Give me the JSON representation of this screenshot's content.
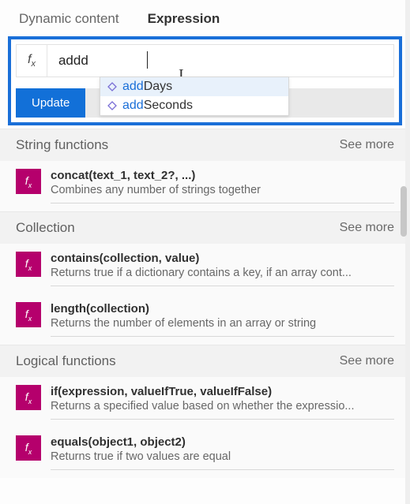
{
  "tabs": {
    "dynamic": "Dynamic content",
    "expression": "Expression"
  },
  "expr": {
    "value": "addd",
    "update": "Update"
  },
  "autocomplete": {
    "item0": {
      "prefix": "add",
      "rest": "Days"
    },
    "item1": {
      "prefix": "add",
      "rest": "Seconds"
    }
  },
  "see_more": "See more",
  "sections": {
    "string": {
      "title": "String functions",
      "fn0": {
        "sig": "concat(text_1, text_2?, ...)",
        "desc": "Combines any number of strings together"
      }
    },
    "collection": {
      "title": "Collection",
      "fn0": {
        "sig": "contains(collection, value)",
        "desc": "Returns true if a dictionary contains a key, if an array cont..."
      },
      "fn1": {
        "sig": "length(collection)",
        "desc": "Returns the number of elements in an array or string"
      }
    },
    "logical": {
      "title": "Logical functions",
      "fn0": {
        "sig": "if(expression, valueIfTrue, valueIfFalse)",
        "desc": "Returns a specified value based on whether the expressio..."
      },
      "fn1": {
        "sig": "equals(object1, object2)",
        "desc": "Returns true if two values are equal"
      }
    }
  }
}
